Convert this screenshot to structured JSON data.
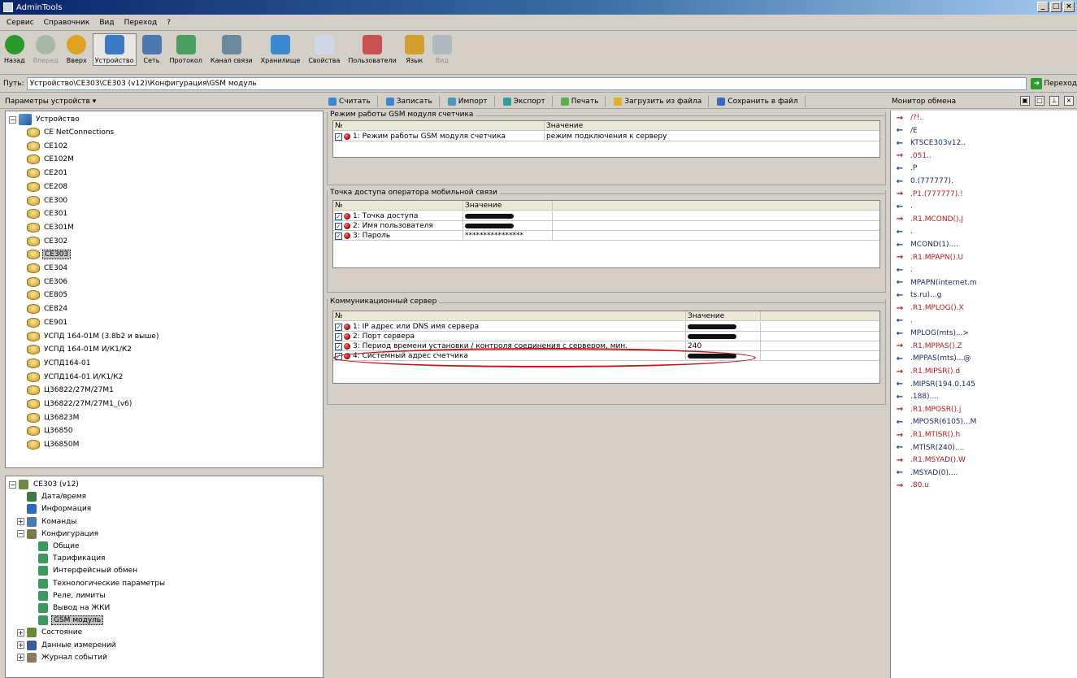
{
  "window": {
    "title": "AdminTools",
    "controls": [
      "_",
      "□",
      "×"
    ]
  },
  "menu": [
    "Сервис",
    "Справочник",
    "Вид",
    "Переход",
    "?"
  ],
  "toolbar": [
    {
      "label": "Назад",
      "icon": "back-icon",
      "enabled": true,
      "pressed": false
    },
    {
      "label": "Вперед",
      "icon": "forward-icon",
      "enabled": false,
      "pressed": false
    },
    {
      "label": "Вверх",
      "icon": "up-icon",
      "enabled": true,
      "pressed": false
    },
    {
      "label": "Устройство",
      "icon": "device-icon",
      "enabled": true,
      "pressed": true
    },
    {
      "label": "Сеть",
      "icon": "network-icon",
      "enabled": true,
      "pressed": false
    },
    {
      "label": "Протокол",
      "icon": "protocol-icon",
      "enabled": true,
      "pressed": false
    },
    {
      "label": "Канал связи",
      "icon": "channel-icon",
      "enabled": true,
      "pressed": false
    },
    {
      "label": "Хранилище",
      "icon": "storage-icon",
      "enabled": true,
      "pressed": false
    },
    {
      "label": "Свойства",
      "icon": "properties-icon",
      "enabled": true,
      "pressed": false
    },
    {
      "label": "Пользователи",
      "icon": "users-icon",
      "enabled": true,
      "pressed": false
    },
    {
      "label": "Язык",
      "icon": "language-icon",
      "enabled": true,
      "pressed": false
    },
    {
      "label": "Вид",
      "icon": "view-icon",
      "enabled": false,
      "pressed": false
    }
  ],
  "address": {
    "label": "Путь:",
    "value": "Устройство\\CE303\\CE303 (v12)\\Конфигурация\\GSM модуль",
    "go_label": "Переход"
  },
  "left_panel": {
    "header": "Параметры устройств ▾"
  },
  "device_tree": {
    "root": "Устройство",
    "items": [
      "CE NetConnections",
      "CE102",
      "CE102M",
      "CE201",
      "CE208",
      "CE300",
      "CE301",
      "CE301M",
      "CE302",
      "CE303",
      "CE304",
      "CE306",
      "CE805",
      "CE824",
      "CE901",
      "УСПД 164-01М (3.8b2 и выше)",
      "УСПД 164-01М И/К1/К2",
      "УСПД164-01",
      "УСПД164-01 И/К1/К2",
      "Ц36822/27М/27М1",
      "Ц36822/27М/27М1_(v6)",
      "Ц36823М",
      "Ц36850",
      "Ц36850М"
    ],
    "selected": "CE303"
  },
  "config_tree": {
    "root": "CE303 (v12)",
    "level1": [
      "Дата/время",
      "Информация",
      "Команды",
      "Конфигурация"
    ],
    "config_children": [
      "Общие",
      "Тарификация",
      "Интерфейсный обмен",
      "Технологические параметры",
      "Реле, лимиты",
      "Вывод на ЖКИ",
      "GSM модуль"
    ],
    "bottom": [
      "Состояние",
      "Данные измерений",
      "Журнал событий"
    ],
    "selected": "GSM модуль"
  },
  "actions": [
    "Считать",
    "Записать",
    "Импорт",
    "Экспорт",
    "Печать",
    "Загрузить из файла",
    "Сохранить в файл"
  ],
  "groups": [
    {
      "title": "Режим работы GSM модуля счетчика",
      "headers": [
        "№",
        "Значение"
      ],
      "rows": [
        {
          "name": "1: Режим работы GSM модуля счетчика",
          "value": "режим подключения к серверу",
          "redacted": false
        }
      ]
    },
    {
      "title": "Точка доступа оператора мобильной связи",
      "headers": [
        "№",
        "Значение"
      ],
      "rows": [
        {
          "name": "1: Точка доступа",
          "value": "",
          "redacted": true
        },
        {
          "name": "2: Имя пользователя",
          "value": "",
          "redacted": true
        },
        {
          "name": "3: Пароль",
          "value": "****************",
          "redacted": false
        }
      ]
    },
    {
      "title": "Коммуникационный сервер",
      "headers": [
        "№",
        "Значение"
      ],
      "rows": [
        {
          "name": "1: IP адрес или DNS имя сервера",
          "value": "",
          "redacted": true
        },
        {
          "name": "2: Порт сервера",
          "value": "",
          "redacted": true
        },
        {
          "name": "3: Период времени установки / контроля соединения с сервером, мин.",
          "value": "240",
          "redacted": false
        },
        {
          "name": "4: Системный адрес счетчика",
          "value": "",
          "redacted": true
        }
      ]
    }
  ],
  "monitor": {
    "header": "Монитор обмена",
    "lines": [
      {
        "dir": "out",
        "text": "/?!.."
      },
      {
        "dir": "in",
        "text": "/E"
      },
      {
        "dir": "in",
        "text": "KTSCE303v12.."
      },
      {
        "dir": "out",
        "text": ".051.."
      },
      {
        "dir": "in",
        "text": ".P"
      },
      {
        "dir": "in",
        "text": "0.(777777)."
      },
      {
        "dir": "out",
        "text": ".P1.(777777).!"
      },
      {
        "dir": "in",
        "text": "."
      },
      {
        "dir": "out",
        "text": ".R1.MCOND().J"
      },
      {
        "dir": "in",
        "text": "."
      },
      {
        "dir": "in",
        "text": "MCOND(1)...."
      },
      {
        "dir": "out",
        "text": ".R1.MPAPN().U"
      },
      {
        "dir": "in",
        "text": "."
      },
      {
        "dir": "in",
        "text": "MPAPN(internet.m"
      },
      {
        "dir": "in",
        "text": "ts.ru)...g"
      },
      {
        "dir": "out",
        "text": ".R1.MPLOG().X"
      },
      {
        "dir": "in",
        "text": "."
      },
      {
        "dir": "in",
        "text": "MPLOG(mts)...>"
      },
      {
        "dir": "out",
        "text": ".R1.MPPAS().Z"
      },
      {
        "dir": "in",
        "text": ".MPPAS(mts)...@"
      },
      {
        "dir": "out",
        "text": ".R1.MIPSR().d"
      },
      {
        "dir": "in",
        "text": ".MIPSR(194.0.145"
      },
      {
        "dir": "in",
        "text": ".188)...."
      },
      {
        "dir": "out",
        "text": ".R1.MPOSR().j"
      },
      {
        "dir": "in",
        "text": ".MPOSR(6105)...M"
      },
      {
        "dir": "out",
        "text": ".R1.MTISR().h"
      },
      {
        "dir": "in",
        "text": ".MTISR(240)...."
      },
      {
        "dir": "out",
        "text": ".R1.MSYAD().W"
      },
      {
        "dir": "in",
        "text": ".MSYAD(0)...."
      },
      {
        "dir": "out",
        "text": ".80.u"
      }
    ]
  },
  "colors": {
    "title_start": "#0a246a",
    "title_end": "#a6caf0",
    "out_arrow": "#c01818",
    "in_arrow": "#1a3a8a",
    "highlight": "#c01818"
  }
}
